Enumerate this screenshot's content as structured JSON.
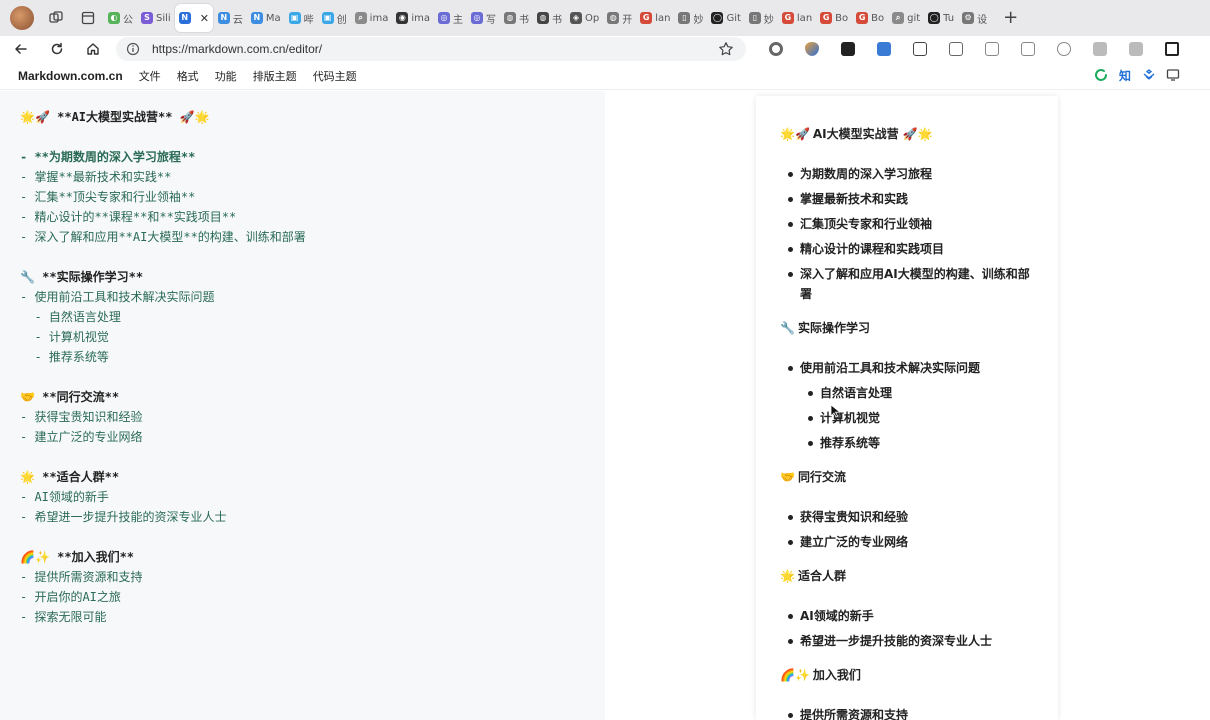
{
  "tabs": [
    {
      "label": "公",
      "color": "#57b35a",
      "glyph": "◐"
    },
    {
      "label": "Sili",
      "color": "#7a5cd6",
      "glyph": "S"
    },
    {
      "label": "",
      "color": "#2b6fd9",
      "glyph": "N",
      "active": true
    },
    {
      "label": "云",
      "color": "#3d8ee0",
      "glyph": "N"
    },
    {
      "label": "Ma",
      "color": "#3d8ee0",
      "glyph": "N"
    },
    {
      "label": "哔",
      "color": "#3aa7e8",
      "glyph": "▣"
    },
    {
      "label": "创",
      "color": "#3aa7e8",
      "glyph": "▣"
    },
    {
      "label": "ima",
      "color": "#8a8a8a",
      "glyph": "⌕"
    },
    {
      "label": "ima",
      "color": "#333333",
      "glyph": "◉"
    },
    {
      "label": "主",
      "color": "#6b6bd6",
      "glyph": "◎"
    },
    {
      "label": "写",
      "color": "#6b6bd6",
      "glyph": "◎"
    },
    {
      "label": "书",
      "color": "#777777",
      "glyph": "◍"
    },
    {
      "label": "书",
      "color": "#444444",
      "glyph": "◍"
    },
    {
      "label": "Op",
      "color": "#555555",
      "glyph": "◈"
    },
    {
      "label": "开",
      "color": "#777777",
      "glyph": "◍"
    },
    {
      "label": "lan",
      "color": "#d64a3a",
      "glyph": "G"
    },
    {
      "label": "妙",
      "color": "#777777",
      "glyph": "▯"
    },
    {
      "label": "Git",
      "color": "#222222",
      "glyph": "◯"
    },
    {
      "label": "妙",
      "color": "#777777",
      "glyph": "▯"
    },
    {
      "label": "lan",
      "color": "#d64a3a",
      "glyph": "G"
    },
    {
      "label": "Bo",
      "color": "#d64a3a",
      "glyph": "G"
    },
    {
      "label": "Bo",
      "color": "#d64a3a",
      "glyph": "G"
    },
    {
      "label": "git",
      "color": "#8a8a8a",
      "glyph": "⌕"
    },
    {
      "label": "Tu",
      "color": "#222222",
      "glyph": "◯"
    },
    {
      "label": "设",
      "color": "#777777",
      "glyph": "⚙"
    }
  ],
  "address": {
    "url": "https://markdown.com.cn/editor/"
  },
  "app": {
    "brand": "Markdown.com.cn",
    "menu": [
      "文件",
      "格式",
      "功能",
      "排版主题",
      "代码主题"
    ],
    "zhi": "知"
  },
  "editor": {
    "lines": [
      {
        "type": "heading",
        "emoji": "🌟🚀",
        "text": " **AI大模型实战营** 🚀🌟"
      },
      {
        "type": "blank"
      },
      {
        "type": "item",
        "text": "- **为期数周的深入学习旅程**"
      },
      {
        "type": "item",
        "text": "- 掌握**最新技术和实践**"
      },
      {
        "type": "item",
        "text": "- 汇集**顶尖专家和行业领袖**"
      },
      {
        "type": "item",
        "text": "- 精心设计的**课程**和**实践项目**"
      },
      {
        "type": "item",
        "text": "- 深入了解和应用**AI大模型**的构建、训练和部署"
      },
      {
        "type": "blank"
      },
      {
        "type": "heading",
        "emoji": "🔧",
        "text": " **实际操作学习**"
      },
      {
        "type": "item",
        "text": "- 使用前沿工具和技术解决实际问题"
      },
      {
        "type": "item",
        "text": "  - 自然语言处理"
      },
      {
        "type": "item",
        "text": "  - 计算机视觉"
      },
      {
        "type": "item",
        "text": "  - 推荐系统等"
      },
      {
        "type": "blank"
      },
      {
        "type": "heading",
        "emoji": "🤝",
        "text": " **同行交流**"
      },
      {
        "type": "item",
        "text": "- 获得宝贵知识和经验"
      },
      {
        "type": "item",
        "text": "- 建立广泛的专业网络"
      },
      {
        "type": "blank"
      },
      {
        "type": "heading",
        "emoji": "🌟",
        "text": " **适合人群**"
      },
      {
        "type": "item",
        "text": "- AI领域的新手"
      },
      {
        "type": "item",
        "text": "- 希望进一步提升技能的资深专业人士"
      },
      {
        "type": "blank"
      },
      {
        "type": "heading",
        "emoji": "🌈✨",
        "text": " **加入我们**"
      },
      {
        "type": "item",
        "text": "- 提供所需资源和支持"
      },
      {
        "type": "item",
        "text": "- 开启你的AI之旅"
      },
      {
        "type": "item",
        "text": "- 探索无限可能"
      }
    ]
  },
  "preview": {
    "sections": [
      {
        "emoji": "🌟🚀",
        "title": "AI大模型实战营 🚀🌟",
        "items": [
          {
            "text": "为期数周的深入学习旅程"
          },
          {
            "text": "掌握最新技术和实践"
          },
          {
            "text": "汇集顶尖专家和行业领袖"
          },
          {
            "text": "精心设计的课程和实践项目"
          },
          {
            "text": "深入了解和应用AI大模型的构建、训练和部署"
          }
        ]
      },
      {
        "emoji": "🔧",
        "title": "实际操作学习",
        "items": [
          {
            "text": "使用前沿工具和技术解决实际问题",
            "sub": [
              "自然语言处理",
              "计算机视觉",
              "推荐系统等"
            ]
          }
        ]
      },
      {
        "emoji": "🤝",
        "title": "同行交流",
        "items": [
          {
            "text": "获得宝贵知识和经验"
          },
          {
            "text": "建立广泛的专业网络"
          }
        ]
      },
      {
        "emoji": "🌟",
        "title": "适合人群",
        "items": [
          {
            "text": "AI领域的新手"
          },
          {
            "text": "希望进一步提升技能的资深专业人士"
          }
        ]
      },
      {
        "emoji": "🌈✨",
        "title": "加入我们",
        "items": [
          {
            "text": "提供所需资源和支持"
          }
        ]
      }
    ]
  },
  "colors": {
    "editor_text": "#2a6b55",
    "editor_bg": "#f7f8fa",
    "accent_green": "#1aab5b",
    "accent_blue": "#1f6fd6"
  }
}
